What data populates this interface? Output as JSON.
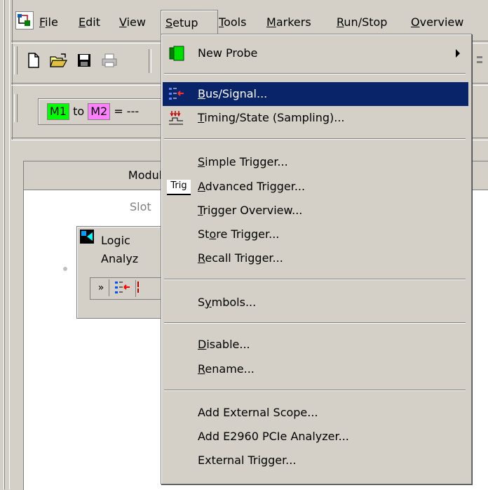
{
  "menubar": {
    "items": [
      {
        "label": "File",
        "u": "F"
      },
      {
        "label": "Edit",
        "u": "E"
      },
      {
        "label": "View",
        "u": "V"
      },
      {
        "label": "Setup",
        "u": "S"
      },
      {
        "label": "Tools",
        "u": "T"
      },
      {
        "label": "Markers",
        "u": "M"
      },
      {
        "label": "Run/Stop",
        "u": "R"
      },
      {
        "label": "Overview",
        "u": "O"
      }
    ]
  },
  "marker": {
    "m1": "M1",
    "to": "to",
    "m2": "M2",
    "suffix": "= ---"
  },
  "modules": {
    "header_label": "Module",
    "slot_label": "Slot",
    "la_line1": "Logic",
    "la_line2": "Analyz"
  },
  "setup_menu": {
    "new_probe": "New Probe",
    "bus_signal": "Bus/Signal...",
    "timing_state": "Timing/State (Sampling)...",
    "simple_trigger": "Simple Trigger...",
    "advanced_trigger": "Advanced Trigger...",
    "advanced_trigger_icon_text": "Trig",
    "trigger_overview": "Trigger Overview...",
    "store_trigger": "Store Trigger...",
    "recall_trigger": "Recall Trigger...",
    "symbols": "Symbols...",
    "disable": "Disable...",
    "rename": "Rename...",
    "add_external_scope": "Add External Scope...",
    "add_e2960": "Add E2960 PCIe Analyzer...",
    "external_trigger": "External Trigger..."
  },
  "colors": {
    "highlight": "#0a246a",
    "m1_bg": "#00ff00",
    "m2_bg": "#ff80ff",
    "menu_bg": "#d4d0c8"
  }
}
